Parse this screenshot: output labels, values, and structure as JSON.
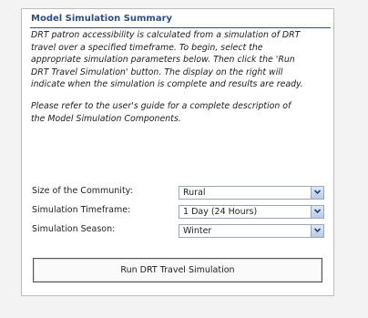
{
  "panel": {
    "title": "Model Simulation Summary",
    "intro_lines": [
      "DRT patron accessibility is calculated from a simulation of DRT",
      "travel over a specified timeframe.  To begin, select the",
      "appropriate simulation parameters below.  Then click the 'Run",
      "DRT Travel Simulation' button.  The display on the right will",
      "indicate when the simulation is complete and results are ready."
    ],
    "reference_lines": [
      "Please refer to the user's guide for a complete description of",
      "the Model Simulation Components."
    ]
  },
  "fields": {
    "community_size": {
      "label": "Size of the Community:",
      "value": "Rural"
    },
    "timeframe": {
      "label": "Simulation Timeframe:",
      "value": "1 Day (24 Hours)"
    },
    "season": {
      "label": "Simulation Season:",
      "value": "Winter"
    }
  },
  "run_button": {
    "label": "Run DRT Travel Simulation"
  },
  "icons": {
    "dropdown": "chevron-down-icon"
  },
  "colors": {
    "title": "#2f4f80",
    "dropdown_button": "#c8d6ec"
  }
}
